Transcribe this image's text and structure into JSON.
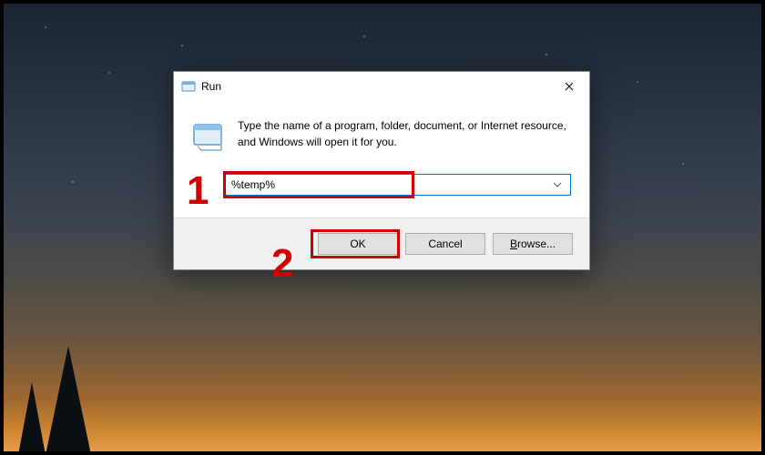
{
  "window": {
    "title": "Run",
    "instruction": "Type the name of a program, folder, document, or Internet resource, and Windows will open it for you."
  },
  "input": {
    "value": "%temp%"
  },
  "buttons": {
    "ok": "OK",
    "cancel": "Cancel",
    "browse_prefix": "B",
    "browse_rest": "rowse..."
  },
  "annotations": {
    "one": "1",
    "two": "2"
  }
}
